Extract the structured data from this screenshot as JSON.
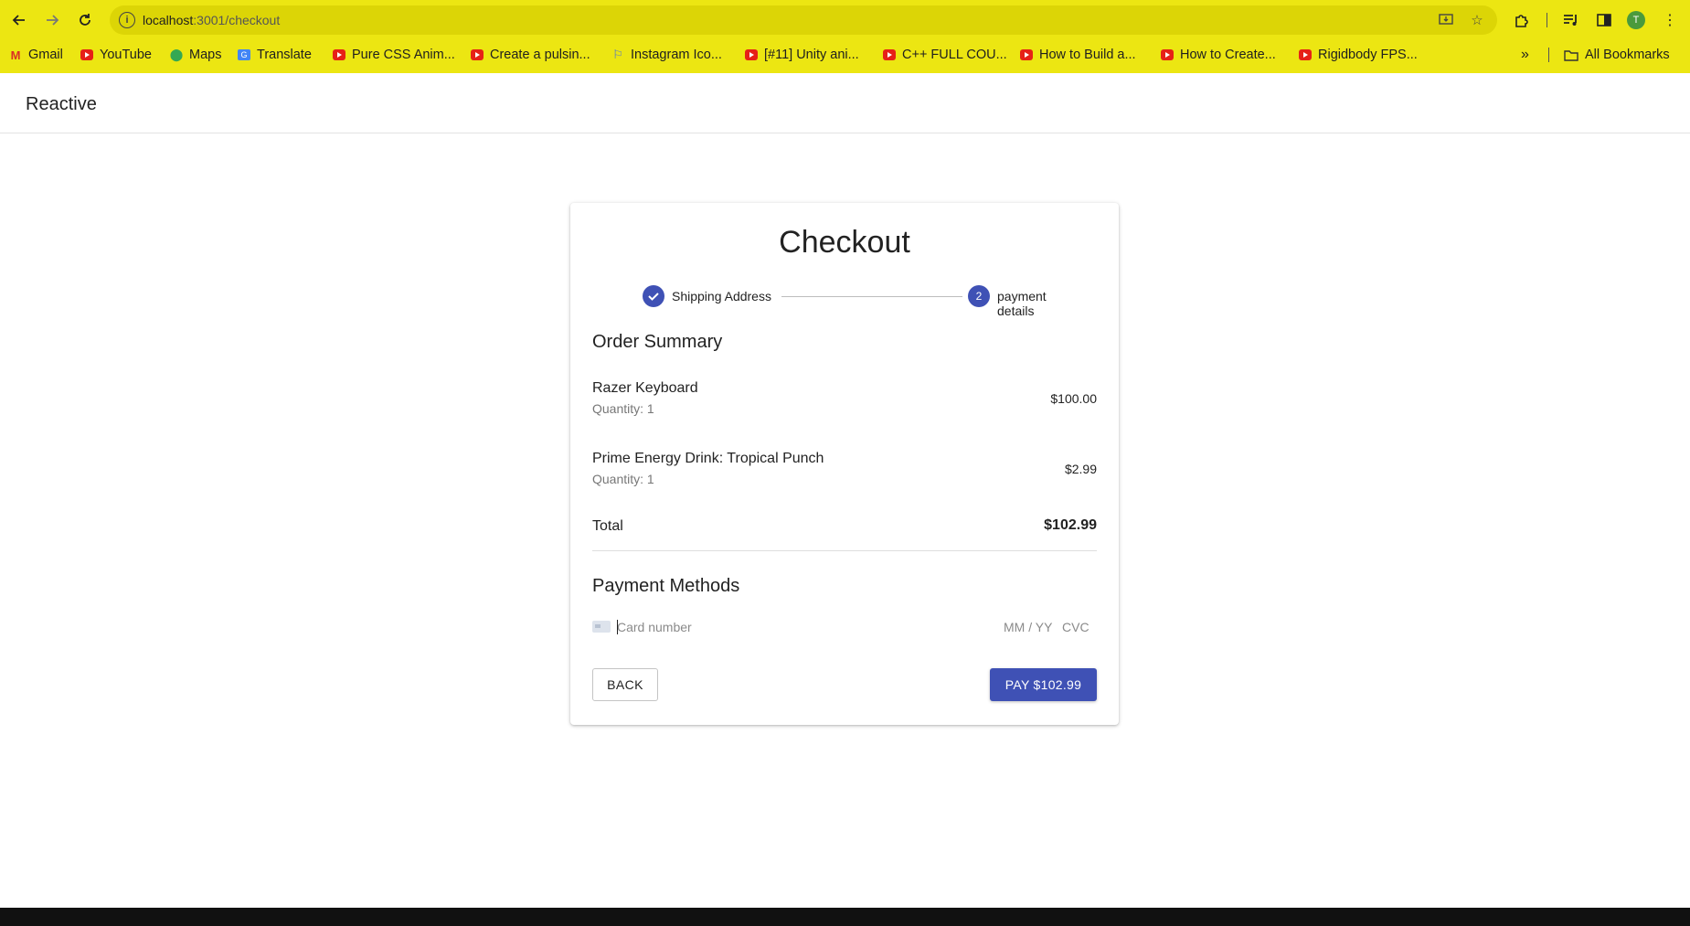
{
  "browser": {
    "url_host": "localhost",
    "url_path": ":3001/checkout",
    "profile_initial": "T",
    "icons": {
      "back": "arrow-left-icon",
      "forward": "arrow-right-icon",
      "reload": "reload-icon",
      "site_info": "info-icon",
      "install": "install-app-icon",
      "star": "star-icon",
      "extensions": "puzzle-icon",
      "media": "media-control-icon",
      "side_panel": "side-panel-icon",
      "menu": "kebab-menu-icon"
    },
    "bookmarks": [
      {
        "label": "Gmail",
        "icon": "gmail-icon"
      },
      {
        "label": "YouTube",
        "icon": "youtube-icon"
      },
      {
        "label": "Maps",
        "icon": "maps-icon"
      },
      {
        "label": "Translate",
        "icon": "translate-icon"
      },
      {
        "label": "Pure CSS Anim...",
        "icon": "youtube-icon"
      },
      {
        "label": "Create a pulsin...",
        "icon": "youtube-icon"
      },
      {
        "label": "Instagram Ico...",
        "icon": "flag-icon"
      },
      {
        "label": "[#11] Unity ani...",
        "icon": "youtube-icon"
      },
      {
        "label": "C++ FULL COU...",
        "icon": "youtube-icon"
      },
      {
        "label": "How to Build a...",
        "icon": "youtube-icon"
      },
      {
        "label": "How to Create...",
        "icon": "youtube-icon"
      },
      {
        "label": "Rigidbody FPS...",
        "icon": "youtube-icon"
      }
    ],
    "bookmarks_overflow": "»",
    "all_bookmarks": "All Bookmarks"
  },
  "app": {
    "title": "Reactive"
  },
  "checkout": {
    "title": "Checkout",
    "steps": [
      {
        "label": "Shipping Address",
        "state": "completed",
        "icon": "check-icon"
      },
      {
        "label": "payment details",
        "state": "active",
        "number": "2"
      }
    ],
    "order_summary_title": "Order Summary",
    "items": [
      {
        "name": "Razer Keyboard",
        "quantity": "Quantity: 1",
        "price": "$100.00"
      },
      {
        "name": "Prime Energy Drink: Tropical Punch",
        "quantity": "Quantity: 1",
        "price": "$2.99"
      }
    ],
    "total_label": "Total",
    "total_value": "$102.99",
    "payment_methods_title": "Payment Methods",
    "card_number_placeholder": "Card number",
    "expiry_placeholder": "MM / YY",
    "cvc_placeholder": "CVC",
    "back_label": "BACK",
    "pay_label": "PAY $102.99"
  },
  "colors": {
    "browser_chrome": "#ece612",
    "primary": "#3f51b5"
  }
}
